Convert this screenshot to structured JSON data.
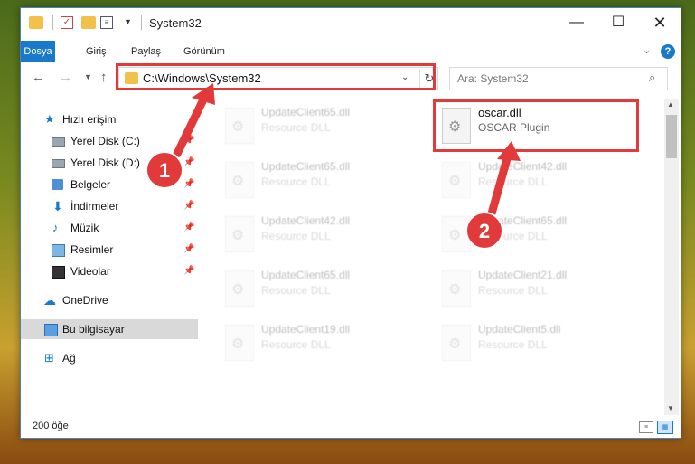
{
  "window": {
    "title": "System32",
    "minimize_glyph": "—",
    "maximize_glyph": "☐",
    "close_glyph": "✕"
  },
  "ribbon": {
    "tabs": [
      "Dosya",
      "Giriş",
      "Paylaş",
      "Görünüm"
    ],
    "help_glyph": "?"
  },
  "nav": {
    "address": "C:\\Windows\\System32",
    "search_placeholder": "Ara: System32"
  },
  "sidebar": {
    "items": [
      {
        "label": "Hızlı erişim",
        "icon": "star-icon",
        "pinned": false
      },
      {
        "label": "Yerel Disk (C:)",
        "icon": "drive-icon",
        "pinned": true
      },
      {
        "label": "Yerel Disk (D:)",
        "icon": "drive-icon",
        "pinned": true
      },
      {
        "label": "Belgeler",
        "icon": "documents-icon",
        "pinned": true
      },
      {
        "label": "İndirmeler",
        "icon": "download-icon",
        "pinned": true
      },
      {
        "label": "Müzik",
        "icon": "music-icon",
        "pinned": true
      },
      {
        "label": "Resimler",
        "icon": "pictures-icon",
        "pinned": true
      },
      {
        "label": "Videolar",
        "icon": "videos-icon",
        "pinned": true
      },
      {
        "label": "OneDrive",
        "icon": "cloud-icon",
        "pinned": false
      },
      {
        "label": "Bu bilgisayar",
        "icon": "computer-icon",
        "pinned": false,
        "selected": true
      },
      {
        "label": "Ağ",
        "icon": "network-icon",
        "pinned": false
      }
    ]
  },
  "files": [
    {
      "name": "UpdateClient65.dll",
      "desc": "Resource DLL",
      "faded": true
    },
    {
      "name": "oscar.dll",
      "desc": "OSCAR Plugin",
      "faded": false
    },
    {
      "name": "UpdateClient65.dll",
      "desc": "Resource DLL",
      "faded": true
    },
    {
      "name": "UpdateClient42.dll",
      "desc": "Resource DLL",
      "faded": true
    },
    {
      "name": "UpdateClient42.dll",
      "desc": "Resource DLL",
      "faded": true
    },
    {
      "name": "UpdateClient65.dll",
      "desc": "Resource DLL",
      "faded": true
    },
    {
      "name": "UpdateClient65.dll",
      "desc": "Resource DLL",
      "faded": true
    },
    {
      "name": "UpdateClient21.dll",
      "desc": "Resource DLL",
      "faded": true
    },
    {
      "name": "UpdateClient19.dll",
      "desc": "Resource DLL",
      "faded": true
    },
    {
      "name": "UpdateClient5.dll",
      "desc": "Resource DLL",
      "faded": true
    }
  ],
  "status": {
    "count": "200 öğe"
  },
  "annotations": {
    "step1": "1",
    "step2": "2",
    "color": "#e23a3a"
  }
}
